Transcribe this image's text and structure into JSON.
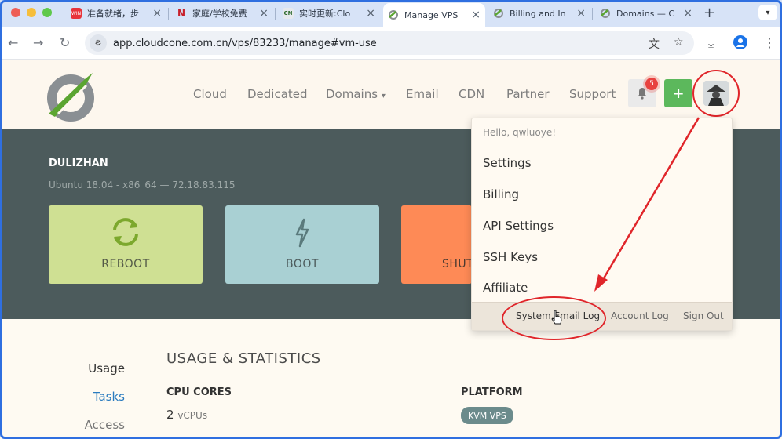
{
  "browser": {
    "tabs": [
      {
        "title": "准备就绪，步",
        "fav_color": "#e8333a",
        "fav_text": "WIN"
      },
      {
        "title": "家庭/学校免费",
        "fav_color": "#ffffff",
        "fav_text": "N"
      },
      {
        "title": "实时更新:Clo",
        "fav_color": "#ffffff",
        "fav_text": "CN"
      },
      {
        "title": "Manage VPS",
        "fav_color": "#ffffff",
        "fav_text": ""
      },
      {
        "title": "Billing and In",
        "fav_color": "#ffffff",
        "fav_text": ""
      },
      {
        "title": "Domains — C",
        "fav_color": "#ffffff",
        "fav_text": ""
      }
    ],
    "address": "app.cloudcone.com.cn/vps/83233/manage#vm-use"
  },
  "header": {
    "nav": [
      "Cloud",
      "Dedicated",
      "Domains",
      "Email",
      "CDN",
      "Partner",
      "Support"
    ],
    "domains_caret": "▾",
    "notification_count": "5",
    "plus_label": "+"
  },
  "vm": {
    "name": "DULIZHAN",
    "info": "Ubuntu 18.04 - x86_64 — 72.18.83.115",
    "actions": {
      "reboot": "REBOOT",
      "boot": "BOOT",
      "shutdown": "SHUT"
    }
  },
  "sidebar": {
    "items": [
      "Usage",
      "Tasks",
      "Access"
    ]
  },
  "usage": {
    "title": "USAGE & STATISTICS",
    "cpu_label": "CPU CORES",
    "cpu_value": "2",
    "cpu_unit": "vCPUs",
    "platform_label": "PLATFORM",
    "platform_value": "KVM VPS"
  },
  "dropdown": {
    "hello": "Hello, qwluoye!",
    "items": [
      "Settings",
      "Billing",
      "API Settings",
      "SSH Keys",
      "Affiliate"
    ],
    "footer": [
      "System Email Log",
      "Account Log",
      "Sign Out"
    ]
  },
  "colors": {
    "annotation": "#e0252a",
    "brand_green": "#5cb85c",
    "band": "#4c5b5c"
  }
}
